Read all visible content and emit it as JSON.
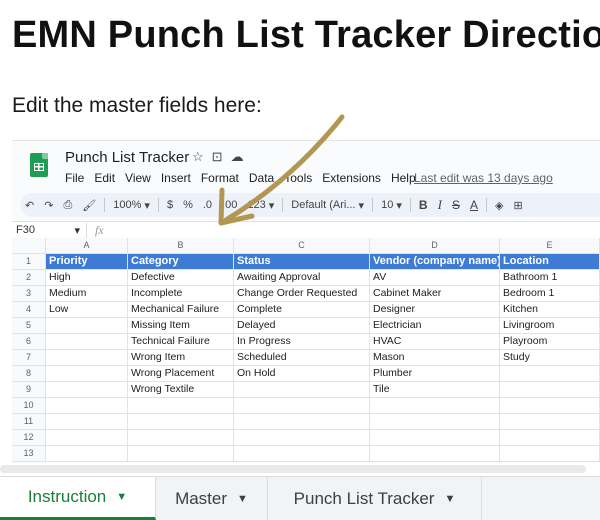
{
  "doc": {
    "title": "EMN Punch List Tracker Directio",
    "paragraph": "Edit the master fields here:"
  },
  "sheet": {
    "title": "Punch List Tracker",
    "menu": [
      "File",
      "Edit",
      "View",
      "Insert",
      "Format",
      "Data",
      "Tools",
      "Extensions",
      "Help"
    ],
    "last_edit": "Last edit was 13 days ago",
    "toolbar": {
      "zoom": "100%",
      "currency": "$",
      "percent": "%",
      "dec_less": ".0",
      "dec_more": ".00",
      "number_format": "123",
      "font": "Default (Ari...",
      "font_size": "10",
      "bold": "B",
      "italic": "I",
      "strike": "S",
      "text_color": "A"
    },
    "name_box": "F30",
    "fx": "fx",
    "columns": [
      "A",
      "B",
      "C",
      "D",
      "E"
    ],
    "row_numbers": [
      "1",
      "2",
      "3",
      "4",
      "5",
      "6",
      "7",
      "8",
      "9",
      "10",
      "11",
      "12",
      "13"
    ],
    "headers": [
      "Priority",
      "Category",
      "Status",
      "Vendor (company name)",
      "Location"
    ],
    "rows": [
      [
        "High",
        "Defective",
        "Awaiting Approval",
        "AV",
        "Bathroom 1"
      ],
      [
        "Medium",
        "Incomplete",
        "Change Order Requested",
        "Cabinet Maker",
        "Bedroom 1"
      ],
      [
        "Low",
        "Mechanical Failure",
        "Complete",
        "Designer",
        "Kitchen"
      ],
      [
        "",
        "Missing Item",
        "Delayed",
        "Electrician",
        "Livingroom"
      ],
      [
        "",
        "Technical Failure",
        "In Progress",
        "HVAC",
        "Playroom"
      ],
      [
        "",
        "Wrong Item",
        "Scheduled",
        "Mason",
        "Study"
      ],
      [
        "",
        "Wrong Placement",
        "On Hold",
        "Plumber",
        ""
      ],
      [
        "",
        "Wrong Textile",
        "",
        "Tile",
        ""
      ],
      [
        "",
        "",
        "",
        "",
        ""
      ],
      [
        "",
        "",
        "",
        "",
        ""
      ],
      [
        "",
        "",
        "",
        "",
        ""
      ],
      [
        "",
        "",
        "",
        "",
        ""
      ]
    ]
  },
  "tabs": [
    {
      "label": "Instruction",
      "active": true
    },
    {
      "label": "Master",
      "active": false
    },
    {
      "label": "Punch List Tracker",
      "active": false
    }
  ],
  "colors": {
    "header_fill": "#3d7bd4",
    "active_tab": "#188038",
    "arrow": "#b39651"
  }
}
